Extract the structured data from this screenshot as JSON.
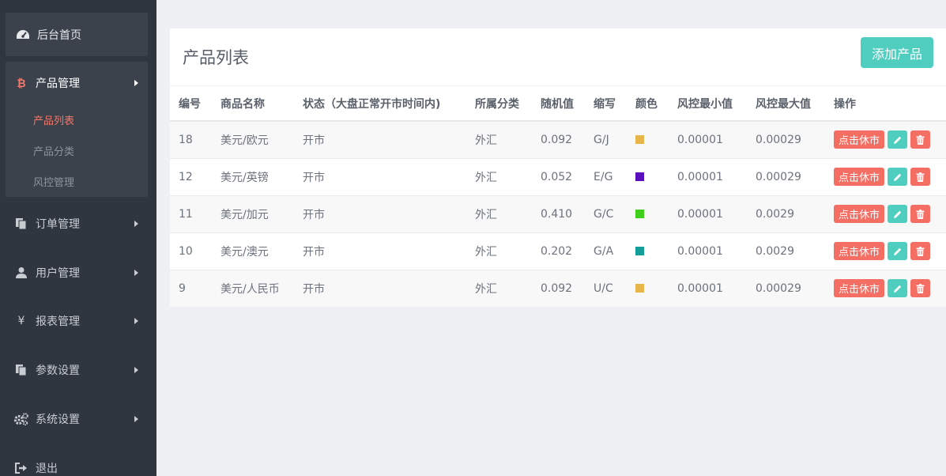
{
  "sidebar": {
    "home": "后台首页",
    "product_group": {
      "label": "产品管理",
      "items": [
        "产品列表",
        "产品分类",
        "风控管理"
      ]
    },
    "items": [
      "订单管理",
      "用户管理",
      "报表管理",
      "参数设置",
      "系统设置",
      "退出"
    ]
  },
  "panel": {
    "title": "产品列表",
    "add_label": "添加产品"
  },
  "table": {
    "headers": [
      "编号",
      "商品名称",
      "状态（大盘正常开市时间内)",
      "所属分类",
      "随机值",
      "缩写",
      "颜色",
      "风控最小值",
      "风控最大值",
      "操作"
    ],
    "rows": [
      {
        "id": "18",
        "name": "美元/欧元",
        "status": "开市",
        "category": "外汇",
        "random": "0.092",
        "abbr": "G/J",
        "color": "#e8b54a",
        "min": "0.00001",
        "max": "0.00029",
        "action": "点击休市"
      },
      {
        "id": "12",
        "name": "美元/英镑",
        "status": "开市",
        "category": "外汇",
        "random": "0.052",
        "abbr": "E/G",
        "color": "#5b0ebe",
        "min": "0.00001",
        "max": "0.00029",
        "action": "点击休市"
      },
      {
        "id": "11",
        "name": "美元/加元",
        "status": "开市",
        "category": "外汇",
        "random": "0.410",
        "abbr": "G/C",
        "color": "#3fcf1c",
        "min": "0.00001",
        "max": "0.0029",
        "action": "点击休市"
      },
      {
        "id": "10",
        "name": "美元/澳元",
        "status": "开市",
        "category": "外汇",
        "random": "0.202",
        "abbr": "G/A",
        "color": "#139e99",
        "min": "0.00001",
        "max": "0.0029",
        "action": "点击休市"
      },
      {
        "id": "9",
        "name": "美元/人民币",
        "status": "开市",
        "category": "外汇",
        "random": "0.092",
        "abbr": "U/C",
        "color": "#e8b54a",
        "min": "0.00001",
        "max": "0.00029",
        "action": "点击休市"
      }
    ]
  }
}
